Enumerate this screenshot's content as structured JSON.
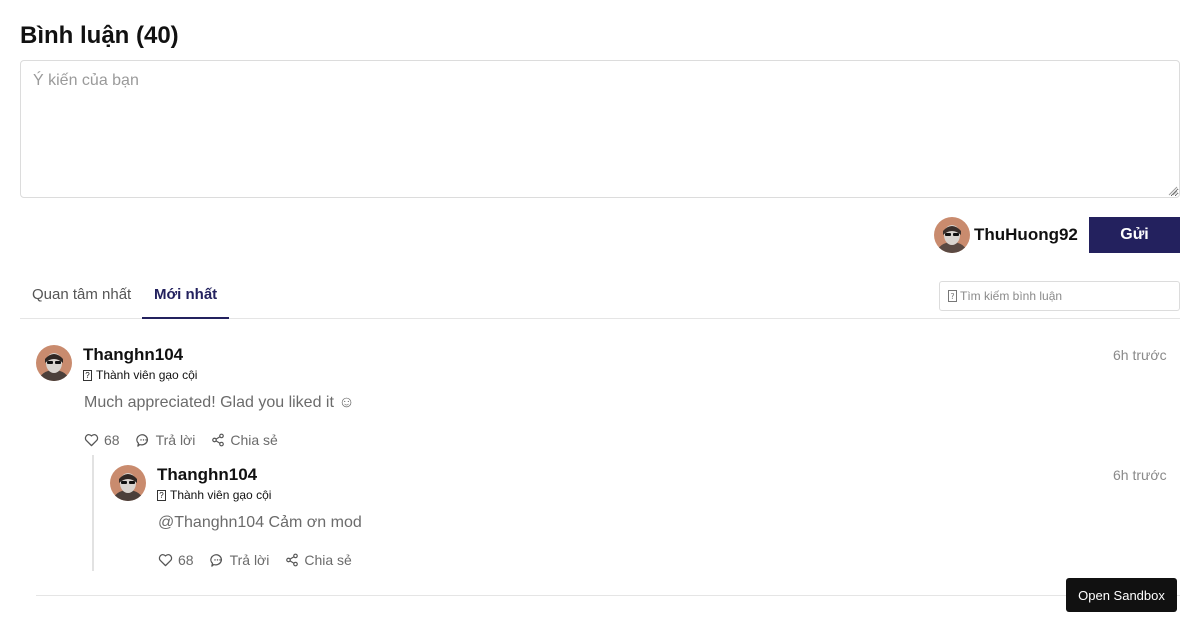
{
  "header": {
    "title": "Bình luận (40)"
  },
  "composer": {
    "placeholder": "Ý kiến của bạn",
    "username": "ThuHuong92",
    "send_label": "Gửi"
  },
  "tabs": [
    {
      "label": "Quan tâm nhất",
      "active": false
    },
    {
      "label": "Mới nhất",
      "active": true
    }
  ],
  "search": {
    "placeholder": "Tìm kiếm bình luận",
    "icon": "search-icon"
  },
  "comments": [
    {
      "author": "Thanghn104",
      "badge": "Thành viên gạo cội",
      "time": "6h trước",
      "text": "Much appreciated! Glad you liked it ☺",
      "likes": "68",
      "reply_label": "Trả lời",
      "share_label": "Chia sẻ",
      "replies": [
        {
          "author": "Thanghn104",
          "badge": "Thành viên gạo cội",
          "time": "6h trước",
          "text": "@Thanghn104 Cảm ơn mod",
          "likes": "68",
          "reply_label": "Trả lời",
          "share_label": "Chia sẻ"
        }
      ]
    }
  ],
  "sandbox": {
    "label": "Open Sandbox"
  },
  "colors": {
    "accent": "#23215e",
    "muted": "#6b6b6b",
    "border": "#dcdcdc"
  }
}
